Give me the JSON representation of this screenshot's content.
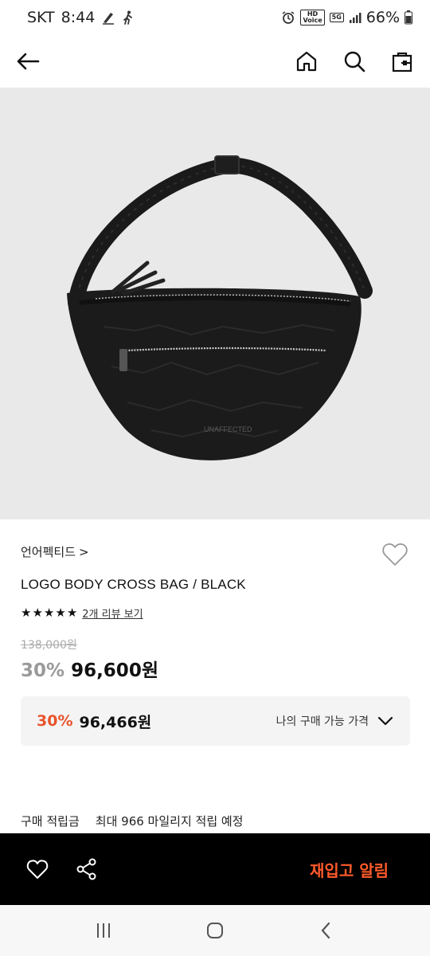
{
  "status_bar": {
    "carrier": "SKT",
    "time": "8:44",
    "battery": "66%",
    "hd_badge": "HD\nVoice",
    "network_badge": "5G"
  },
  "header": {
    "back_icon": "arrow-left-icon",
    "home_icon": "home-icon",
    "search_icon": "search-icon",
    "cart_icon": "shopping-bag-icon"
  },
  "product": {
    "brand": "언어펙티드",
    "brand_chevron": ">",
    "name": "LOGO BODY CROSS BAG / BLACK",
    "rating_stars": 5,
    "review_link": "2개 리뷰 보기",
    "original_price": "138,000원",
    "discount_rate": "30%",
    "sale_price": "96,600원",
    "bag_logo": "UNAFFECTED"
  },
  "my_price": {
    "discount_rate": "30%",
    "price": "96,466원",
    "label": "나의 구매 가능 가격"
  },
  "points": {
    "label": "구매 적립금",
    "value": "최대 966 마일리지 적립 예정"
  },
  "action_bar": {
    "restock_label": "재입고 알림"
  },
  "colors": {
    "accent": "#e8542b",
    "restock": "#ff5a2b",
    "action_bar_bg": "#000000",
    "image_bg": "#e9e9e9"
  }
}
